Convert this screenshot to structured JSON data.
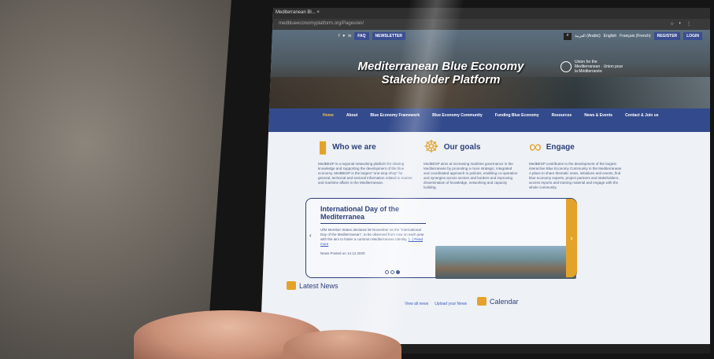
{
  "browser": {
    "tab_title": "Mediterranean Bl... ×",
    "url": "medblueeconomyplatform.org/Pages/en/"
  },
  "topbar": {
    "fb": "f",
    "tw": "♥",
    "li": "in",
    "faq": "FAQ",
    "newsletter": "NEWSLETTER",
    "lang_ar": "العربية (Arabic)",
    "lang_en": "English",
    "lang_fr": "Français (French)",
    "register": "REGISTER",
    "login": "LOGIN"
  },
  "hero": {
    "title_line1": "Mediterranean Blue Economy",
    "title_line2": "Stakeholder Platform",
    "ufm_text": "Union for the Mediterranean · Union pour la Méditerranée"
  },
  "nav": [
    "Home",
    "About",
    "Blue Economy Framework",
    "Blue Economy Community",
    "Funding Blue Economy",
    "Resources",
    "News & Events",
    "Contact & Join us"
  ],
  "columns": [
    {
      "icon": "lighthouse-icon",
      "glyph": "▮",
      "title": "Who we are",
      "text": "MedBESP is a regional networking platform for sharing knowledge and supporting the development of the blue economy. MedBESP is the largest \"one-stop-shop\" for general, technical and sectoral information related to marine and maritime affairs in the Mediterranean."
    },
    {
      "icon": "ship-wheel-icon",
      "glyph": "☸",
      "title": "Our goals",
      "text": "MedBESP aims at increasing maritime governance in the Mediterranean by promoting a more strategic, integrated and coordinated approach to policies, enabling co-operation and synergies across sectors and borders and improving dissemination of knowledge, networking and capacity building."
    },
    {
      "icon": "knot-icon",
      "glyph": "∞",
      "title": "Engage",
      "text": "MedBESP contributes to the development of the largest interactive Blue Economy Community in the Mediterranean. A place to share thematic news, initiatives and events, find blue economy experts, project partners and stakeholders, access reports and training material and engage with the whole community."
    }
  ],
  "carousel": {
    "title": "International Day of the Mediterranea",
    "text": "UfM Member States declared 28 November as the \"International Day of the Mediterranean\", to be observed from now on each year with the aim to foster a common Mediterranean identity.",
    "read": "[...] Read more",
    "meta": "News  Posted on 14.12.2020",
    "prev": "‹",
    "next": "›"
  },
  "latest": {
    "title": "Latest News",
    "view_all": "View all news",
    "upload": "Upload your News",
    "calendar": "Calendar"
  },
  "colors": {
    "brand_blue": "#334a8c",
    "accent_gold": "#e3a32b"
  }
}
